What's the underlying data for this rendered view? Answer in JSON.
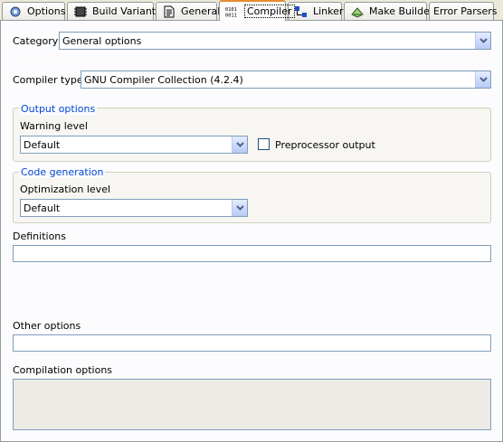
{
  "tabs": [
    {
      "label": "Options",
      "icon": "options-icon"
    },
    {
      "label": "Build Variants",
      "icon": "chip-icon"
    },
    {
      "label": "General",
      "icon": "document-icon"
    },
    {
      "label": "Compiler",
      "icon": "binary-icon"
    },
    {
      "label": "Linker",
      "icon": "linker-icon"
    },
    {
      "label": "Make Builder",
      "icon": "make-icon"
    },
    {
      "label": "Error Parsers",
      "icon": ""
    }
  ],
  "category": {
    "label": "Category",
    "value": "General options"
  },
  "compiler_type": {
    "label": "Compiler type:",
    "value": "GNU Compiler Collection (4.2.4)"
  },
  "output_options": {
    "title": "Output options",
    "warning_label": "Warning level",
    "warning_value": "Default",
    "preprocessor_label": "Preprocessor output"
  },
  "code_generation": {
    "title": "Code generation",
    "optimization_label": "Optimization level",
    "optimization_value": "Default"
  },
  "definitions": {
    "label": "Definitions",
    "value": ""
  },
  "other_options": {
    "label": "Other options",
    "value": ""
  },
  "compilation_options": {
    "label": "Compilation options",
    "value": ""
  },
  "colors": {
    "accent": "#e68b2c",
    "group_title": "#0046d5"
  }
}
